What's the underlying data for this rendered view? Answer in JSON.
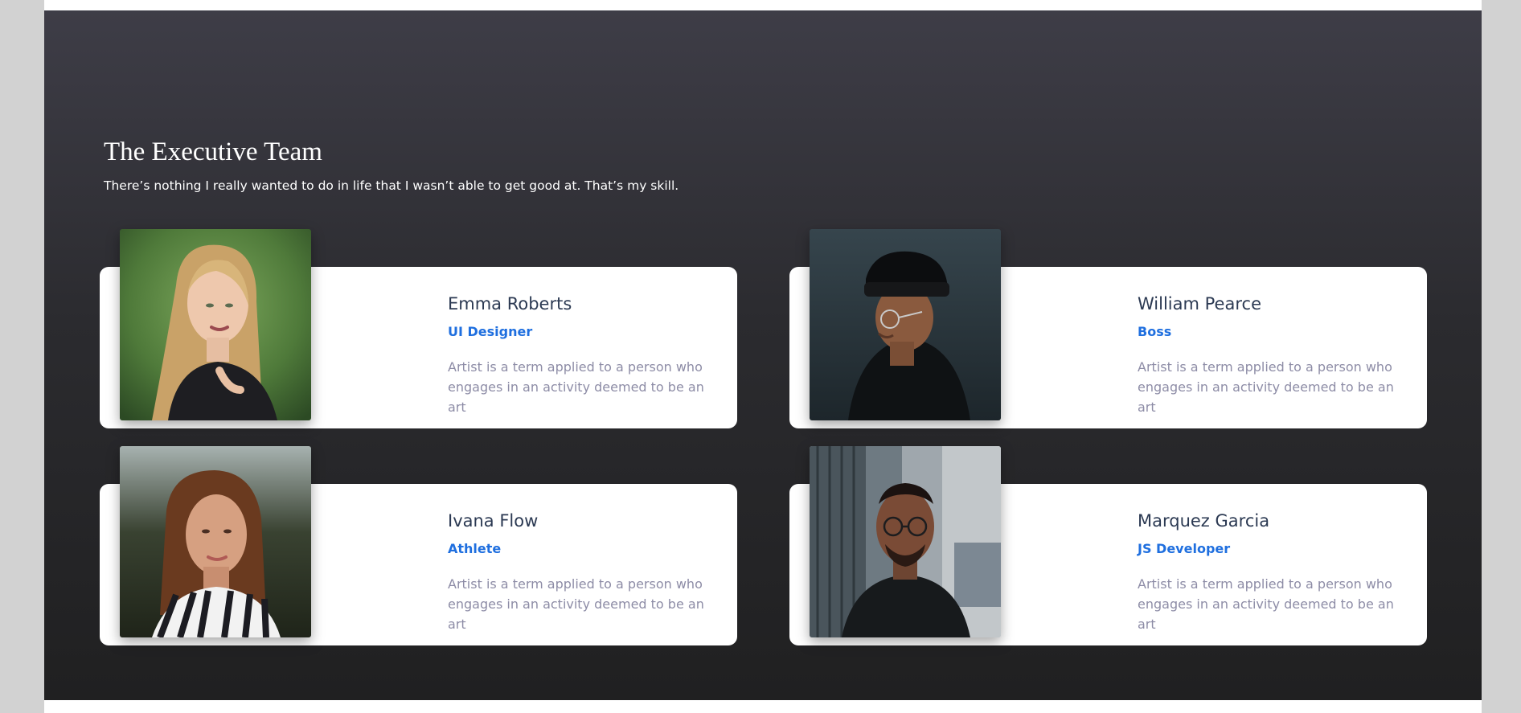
{
  "team": {
    "title": "The Executive Team",
    "subtitle": "There’s nothing I really wanted to do in life that I wasn’t able to get good at. That’s my skill.",
    "members": [
      {
        "name": "Emma Roberts",
        "role": "UI Designer",
        "description": "Artist is a term applied to a person who engages in an activity deemed to be an art",
        "photo_alt": "Portrait of Emma Roberts"
      },
      {
        "name": "William Pearce",
        "role": "Boss",
        "description": "Artist is a term applied to a person who engages in an activity deemed to be an art",
        "photo_alt": "Portrait of William Pearce"
      },
      {
        "name": "Ivana Flow",
        "role": "Athlete",
        "description": "Artist is a term applied to a person who engages in an activity deemed to be an art",
        "photo_alt": "Portrait of Ivana Flow"
      },
      {
        "name": "Marquez Garcia",
        "role": "JS Developer",
        "description": "Artist is a term applied to a person who engages in an activity deemed to be an art",
        "photo_alt": "Portrait of Marquez Garcia"
      }
    ]
  },
  "colors": {
    "section_background_top": "#3e3d47",
    "section_background_bottom": "#202021",
    "card_background": "#ffffff",
    "name_color": "#2c3a53",
    "role_color": "#1f6fdf",
    "description_color": "#8d8ca6"
  }
}
